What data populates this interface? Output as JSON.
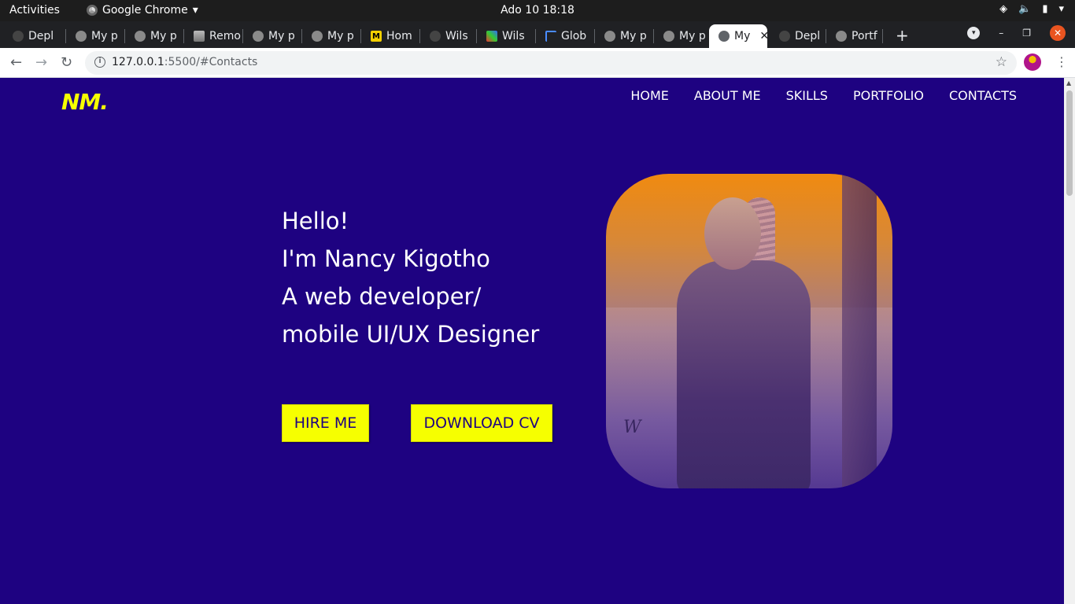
{
  "system": {
    "activities": "Activities",
    "app_name": "Google Chrome",
    "clock": "Ado 10  18:18"
  },
  "tabs": [
    {
      "label": "Depl",
      "icon": "github-icon"
    },
    {
      "label": "My p",
      "icon": "globe-icon"
    },
    {
      "label": "My p",
      "icon": "globe-icon"
    },
    {
      "label": "Remo",
      "icon": "layers-icon"
    },
    {
      "label": "My p",
      "icon": "globe-icon"
    },
    {
      "label": "My p",
      "icon": "globe-icon"
    },
    {
      "label": "Hom",
      "icon": "m-icon"
    },
    {
      "label": "Wils",
      "icon": "github-icon"
    },
    {
      "label": "Wils",
      "icon": "image-icon"
    },
    {
      "label": "Glob",
      "icon": "flag-icon"
    },
    {
      "label": "My p",
      "icon": "globe-icon"
    },
    {
      "label": "My p",
      "icon": "globe-icon"
    },
    {
      "label": "My",
      "icon": "globe-icon",
      "active": true
    },
    {
      "label": "Depl",
      "icon": "github-icon"
    },
    {
      "label": "Portf",
      "icon": "globe-icon"
    }
  ],
  "address": {
    "host": "127.0.0.1",
    "rest": ":5500/#Contacts"
  },
  "site": {
    "logo": "NM.",
    "nav": [
      "HOME",
      "ABOUT ME",
      "SKILLS",
      "PORTFOLIO",
      "CONTACTS"
    ],
    "hero_lines": [
      "Hello!",
      "I'm Nancy Kigotho",
      "A web developer/",
      "mobile UI/UX Designer"
    ],
    "hire_label": "HIRE ME",
    "cv_label": "DOWNLOAD CV",
    "accent_color": "#f6ff00",
    "background_color": "#1e0281"
  }
}
